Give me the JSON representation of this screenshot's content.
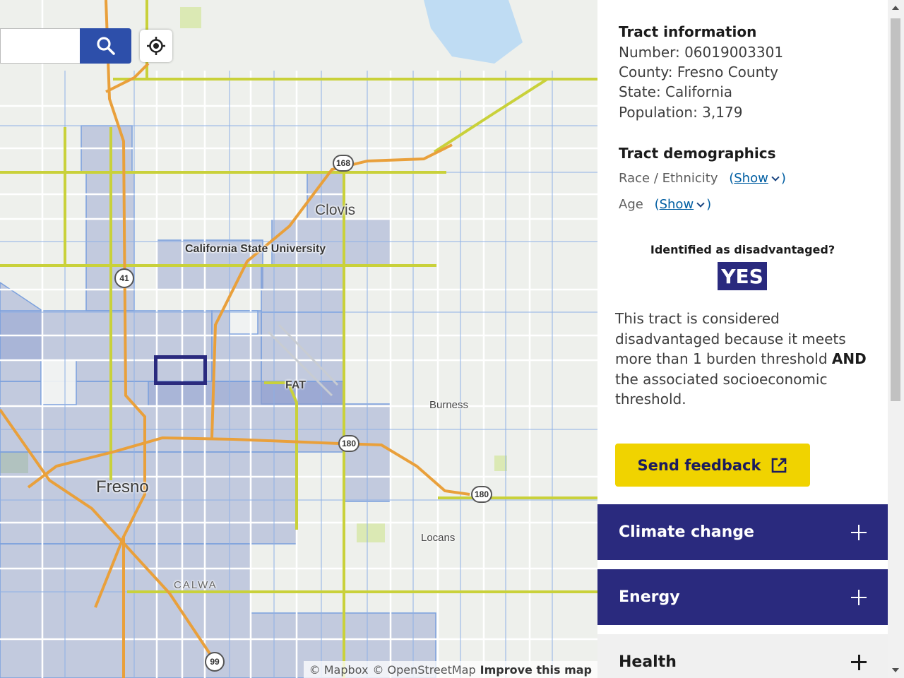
{
  "search": {
    "placeholder": "",
    "search_icon": "search-icon",
    "locate_icon": "crosshair-icon"
  },
  "map": {
    "places": {
      "clovis": "Clovis",
      "csu": "California State University",
      "fat": "FAT",
      "burness": "Burness",
      "fresno": "Fresno",
      "locans": "Locans",
      "calwa": "CALWA"
    },
    "shields": {
      "r168": "168",
      "r41": "41",
      "r180a": "180",
      "r180b": "180",
      "r99": "99"
    },
    "attribution": {
      "mapbox": "© Mapbox",
      "osm": "© OpenStreetMap",
      "improve": "Improve this map"
    },
    "colors": {
      "tract_fill": "#8c9ccf",
      "tract_border": "#7aa0dd",
      "selected_tract": "#2a2a7e",
      "highway": "#e9a03b",
      "arterial": "#c9d13a"
    }
  },
  "panel": {
    "tract_info": {
      "title": "Tract information",
      "number": "Number: 06019003301",
      "county": "County: Fresno County",
      "state": "State: California",
      "population": "Population: 3,179"
    },
    "demographics": {
      "title": "Tract demographics",
      "race_label": "Race / Ethnicity",
      "age_label": "Age",
      "show_label": "Show",
      "open_paren": "(",
      "close_paren": ")"
    },
    "identified": {
      "question": "Identified as disadvantaged?",
      "answer": "YES",
      "text_before": "This tract is considered disadvantaged because it meets more than 1 burden threshold ",
      "text_bold": "AND",
      "text_after": " the associated socioeconomic threshold."
    },
    "feedback": {
      "label": "Send feedback",
      "icon": "external-link-icon"
    },
    "accordions": [
      {
        "label": "Climate change",
        "icon": "plus-icon"
      },
      {
        "label": "Energy",
        "icon": "plus-icon"
      },
      {
        "label": "Health",
        "icon": "plus-icon"
      }
    ]
  }
}
